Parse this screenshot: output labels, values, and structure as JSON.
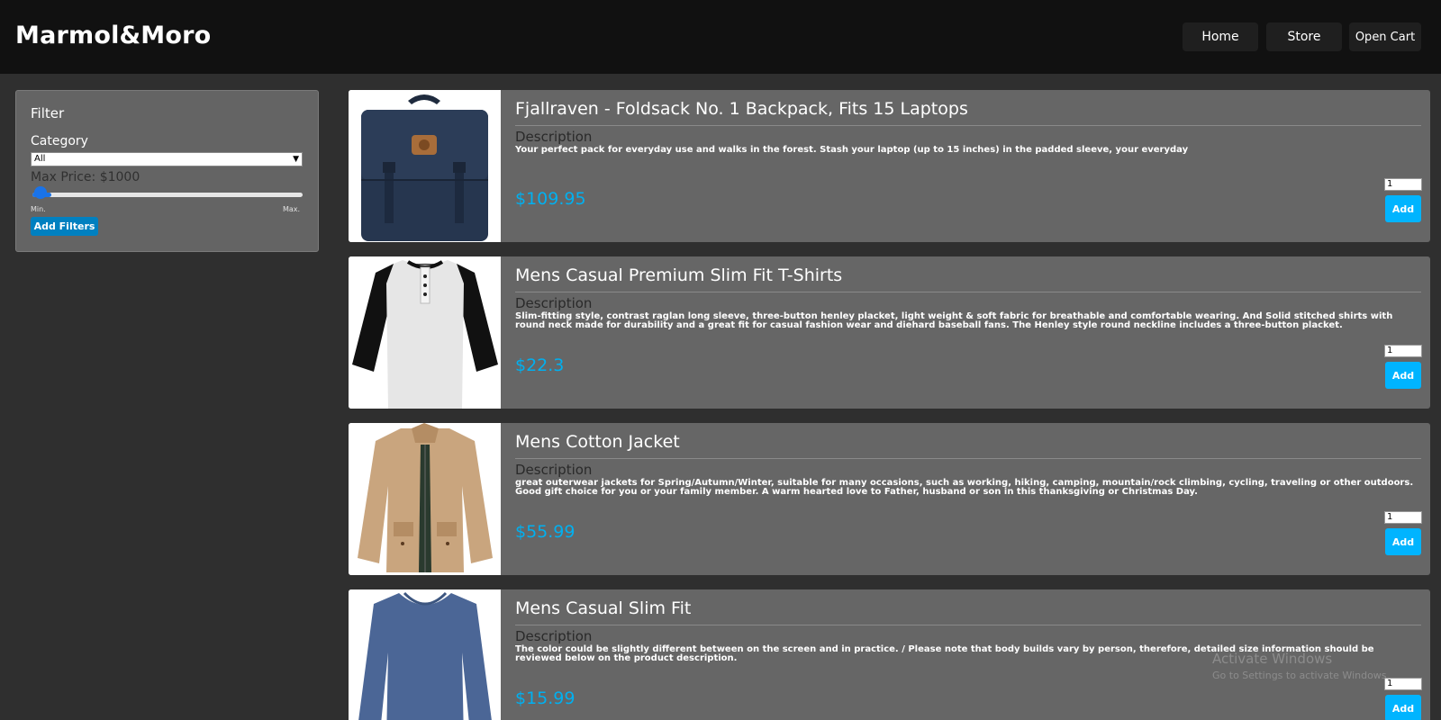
{
  "brand": "Marmol&Moro",
  "nav": {
    "home": "Home",
    "store": "Store",
    "cart": "Open Cart"
  },
  "filter": {
    "title": "Filter",
    "category_label": "Category",
    "category_selected": "All",
    "max_price_label": "Max Price: $1000",
    "max_price_slider_fraction": 0.07,
    "min_label": "Min.",
    "max_label": "Max.",
    "button": "Add Filters"
  },
  "products": [
    {
      "title": "Fjallraven - Foldsack No. 1 Backpack, Fits 15 Laptops",
      "desc_label": "Description",
      "description": "Your perfect pack for everyday use and walks in the forest. Stash your laptop (up to 15 inches) in the padded sleeve, your everyday",
      "price": "$109.95",
      "qty": "1",
      "add": "Add",
      "image": "backpack-image"
    },
    {
      "title": "Mens Casual Premium Slim Fit T-Shirts",
      "desc_label": "Description",
      "description": "Slim-fitting style, contrast raglan long sleeve, three-button henley placket, light weight & soft fabric for breathable and comfortable wearing. And Solid stitched shirts with round neck made for durability and a great fit for casual fashion wear and diehard baseball fans. The Henley style round neckline includes a three-button placket.",
      "price": "$22.3",
      "qty": "1",
      "add": "Add",
      "image": "tshirt-image"
    },
    {
      "title": "Mens Cotton Jacket",
      "desc_label": "Description",
      "description": "great outerwear jackets for Spring/Autumn/Winter, suitable for many occasions, such as working, hiking, camping, mountain/rock climbing, cycling, traveling or other outdoors. Good gift choice for you or your family member. A warm hearted love to Father, husband or son in this thanksgiving or Christmas Day.",
      "price": "$55.99",
      "qty": "1",
      "add": "Add",
      "image": "jacket-image"
    },
    {
      "title": "Mens Casual Slim Fit",
      "desc_label": "Description",
      "description": "The color could be slightly different between on the screen and in practice. / Please note that body builds vary by person, therefore, detailed size information should be reviewed below on the product description.",
      "price": "$15.99",
      "qty": "1",
      "add": "Add",
      "image": "slim-fit-shirt-image"
    }
  ],
  "watermark": {
    "title": "Activate Windows",
    "subtitle": "Go to Settings to activate Windows."
  },
  "colors": {
    "header_bg": "#111111",
    "page_bg": "#2f2f2f",
    "card_bg": "#666666",
    "price": "#00b0f0",
    "add_button": "#00b4ff",
    "filter_button": "#0080c0"
  }
}
